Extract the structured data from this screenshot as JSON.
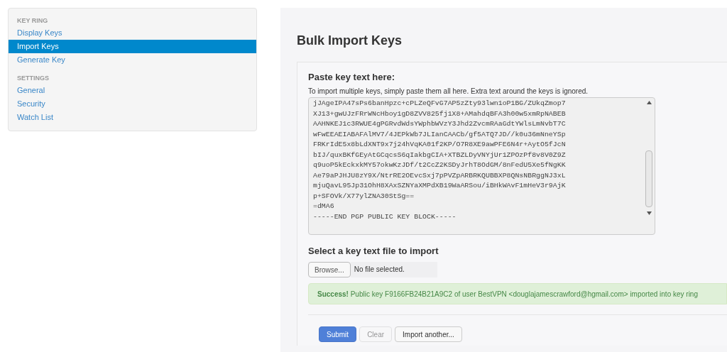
{
  "sidebar": {
    "sections": [
      {
        "heading": "KEY RING",
        "items": [
          {
            "label": "Display Keys",
            "selected": false
          },
          {
            "label": "Import Keys",
            "selected": true
          },
          {
            "label": "Generate Key",
            "selected": false
          }
        ]
      },
      {
        "heading": "SETTINGS",
        "items": [
          {
            "label": "General",
            "selected": false
          },
          {
            "label": "Security",
            "selected": false
          },
          {
            "label": "Watch List",
            "selected": false
          }
        ]
      }
    ]
  },
  "page_title": "Bulk Import Keys",
  "paste": {
    "heading": "Paste key text here:",
    "help": "To import multiple keys, simply paste them all here. Extra text around the keys is ignored.",
    "value": "jJAgeIPA47sPs6banHpzc+cPLZeQFvG7AP5zZty93lwn1oP1BG/ZUkqZmop7\nXJ13+gwUJzFRrWNcHboy1gD8ZVV825fj1X8+AMahdqBFA3h00w5xmRpNABEB\nAAHNKEJ1c3RWUE4gPGRvdWdsYWphbWVzY3Jhd2ZvcmRAaGdtYWlsLmNvbT7C\nwFwEEAEIABAFAlMV7/4JEPkWb7JLIanCAACb/gf5ATQ7JD//k0u36mNneYSp\nFRKrIdE5x8bLdXNT9x7j24hVqKA01f2KP/O7R8XE9awPFE6N4r+AytO5fJcN\nbIJ/quxBKfGEyAtGCqcsS6qIakbgCIA+XTBZLDyVNYjUr1ZPOzPf8v8V0Z9Z\nq9uoP5kEckxkMY57okwKzJDf/t2CcZ2KSDyJrhT8OdGM/8nFedU5Xe5fNgKK\nAe79aPJHJU8zY9X/NtrRE2OEvcSxj7pPVZpARBRKQUBBXP8QNsNBRggNJ3xL\nmjuQavL95Jp31OhH8XAxSZNYaXMPdXB19WaARSou/iBHkWAvF1mHeV3r9AjK\np+SFOVk/X77ylZNA30StSg==\n=dMA6\n-----END PGP PUBLIC KEY BLOCK-----"
  },
  "file": {
    "heading": "Select a key text file to import",
    "browse": "Browse...",
    "status": "No file selected."
  },
  "alert": {
    "text": "**Success!** Public key F9166FB24B21A9C2 of user BestVPN <douglajamescrawford@hgmail.com> imported into key ring"
  },
  "buttons": [
    {
      "label": "Submit",
      "kind": "primary",
      "disabled": false
    },
    {
      "label": "Clear",
      "kind": "default",
      "disabled": true
    },
    {
      "label": "Import another...",
      "kind": "default",
      "disabled": false
    }
  ]
}
